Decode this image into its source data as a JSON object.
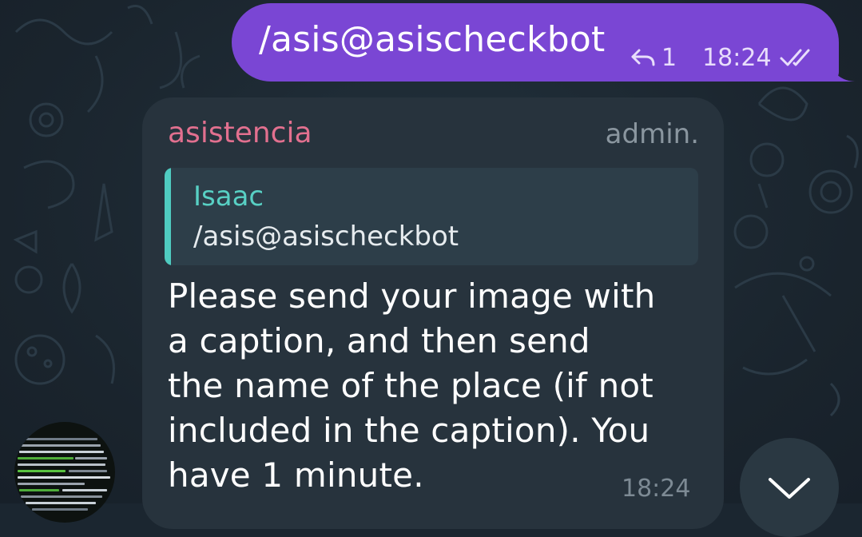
{
  "outgoing_message": {
    "text": "/asis@asischeckbot",
    "reply_count": "1",
    "time": "18:24",
    "status": "read"
  },
  "incoming_message": {
    "sender": "asistencia",
    "badge": "admin.",
    "quote": {
      "author": "Isaac",
      "text": "/asis@asischeckbot"
    },
    "lines": [
      "Please send your image with",
      "a caption, and then send",
      "the name of the place (if not",
      "included in the caption). You",
      "have 1 minute."
    ],
    "time": "18:24"
  },
  "colors": {
    "outgoing_bubble": "#7a46d4",
    "incoming_bubble": "#27333d",
    "sender_name": "#e2708f",
    "quote_accent": "#4fcbc0",
    "background": "#1b2630"
  },
  "icons": {
    "reply": "reply-arrow-icon",
    "read_receipt": "double-check-icon",
    "scroll": "chevron-down-icon"
  }
}
